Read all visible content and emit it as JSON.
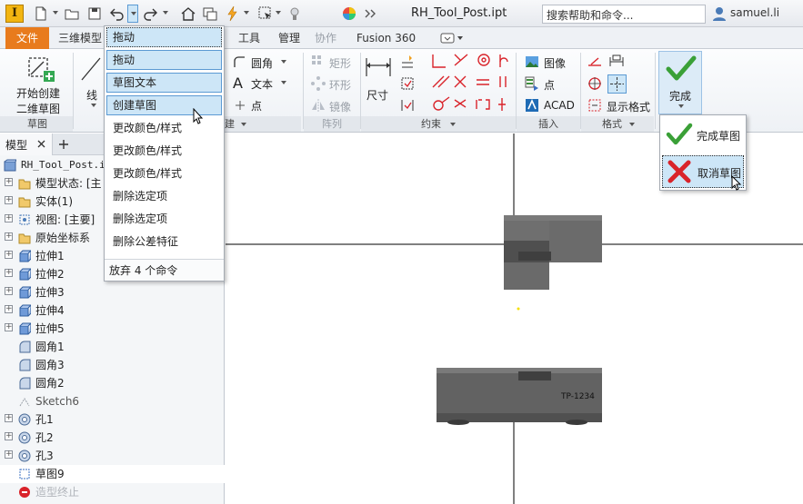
{
  "app": {
    "logo_letter": "I"
  },
  "titlebar": {
    "document_title": "RH_Tool_Post.ipt",
    "help_search_value": "搜索帮助和命令...",
    "user_name": "samuel.li"
  },
  "tabs": {
    "file": "文件",
    "model_3d": "三维模型",
    "tools": "工具",
    "manage": "管理",
    "collaborate": "协作",
    "fusion": "Fusion 360"
  },
  "ribbon": {
    "start_sketch_line1": "开始创建",
    "start_sketch_line2": "二维草图",
    "sketch_panel": "草图",
    "line": "线",
    "fillet": "圆角",
    "text": "文本",
    "point": "点",
    "create_panel": "建",
    "rectangle": "矩形",
    "ring": "环形",
    "mirror": "镜像",
    "pattern_panel": "阵列",
    "dimension": "尺寸",
    "constrain_panel": "约束",
    "image": "图像",
    "points": "点",
    "acad": "ACAD",
    "insert_panel": "插入",
    "show_format": "显示格式",
    "format_panel": "格式",
    "finish": "完成"
  },
  "undo_menu": {
    "top_item": "拖动",
    "items": [
      "拖动",
      "草图文本",
      "创建草图",
      "更改颜色/样式",
      "更改颜色/样式",
      "更改颜色/样式",
      "删除选定项",
      "删除选定项",
      "删除公差特征"
    ],
    "footer": "放弃 4 个命令"
  },
  "finish_menu": {
    "finish_sketch": "完成草图",
    "cancel_sketch": "取消草图"
  },
  "browser": {
    "tab_label": "模型",
    "tree": [
      {
        "label": "RH_Tool_Post.ipt",
        "icon": "part-icon",
        "plus": false,
        "indent": 0
      },
      {
        "label": "模型状态: [主",
        "icon": "folder-icon",
        "plus": true,
        "indent": 1
      },
      {
        "label": "实体(1)",
        "icon": "folder-icon",
        "plus": true,
        "indent": 1
      },
      {
        "label": "视图: [主要]",
        "icon": "view-icon",
        "plus": true,
        "indent": 1
      },
      {
        "label": "原始坐标系",
        "icon": "folder-icon",
        "plus": true,
        "indent": 1
      },
      {
        "label": "拉伸1",
        "icon": "extrude-icon",
        "plus": true,
        "indent": 1
      },
      {
        "label": "拉伸2",
        "icon": "extrude-icon",
        "plus": true,
        "indent": 1
      },
      {
        "label": "拉伸3",
        "icon": "extrude-icon",
        "plus": true,
        "indent": 1
      },
      {
        "label": "拉伸4",
        "icon": "extrude-icon",
        "plus": true,
        "indent": 1
      },
      {
        "label": "拉伸5",
        "icon": "extrude-icon",
        "plus": true,
        "indent": 1
      },
      {
        "label": "圆角1",
        "icon": "fillet-icon",
        "plus": false,
        "indent": 1
      },
      {
        "label": "圆角3",
        "icon": "fillet-icon",
        "plus": false,
        "indent": 1
      },
      {
        "label": "圆角2",
        "icon": "fillet-icon",
        "plus": false,
        "indent": 1
      },
      {
        "label": "Sketch6",
        "icon": "sketch-dim-icon",
        "plus": false,
        "indent": 1
      },
      {
        "label": "孔1",
        "icon": "hole-icon",
        "plus": true,
        "indent": 1
      },
      {
        "label": "孔2",
        "icon": "hole-icon",
        "plus": true,
        "indent": 1
      },
      {
        "label": "孔3",
        "icon": "hole-icon",
        "plus": true,
        "indent": 1
      },
      {
        "label": "草图9",
        "icon": "sketch-icon",
        "plus": false,
        "indent": 1
      },
      {
        "label": "造型终止",
        "icon": "end-of-part-icon",
        "plus": false,
        "indent": 1
      }
    ]
  },
  "graphics": {
    "part_label": "TP-1234"
  },
  "colors": {
    "file_tab": "#e87b1d",
    "finish_check": "#3aa037",
    "cancel_x": "#d9232a",
    "selection": "#cde6f7",
    "part_grey": "#6b6b6b"
  }
}
